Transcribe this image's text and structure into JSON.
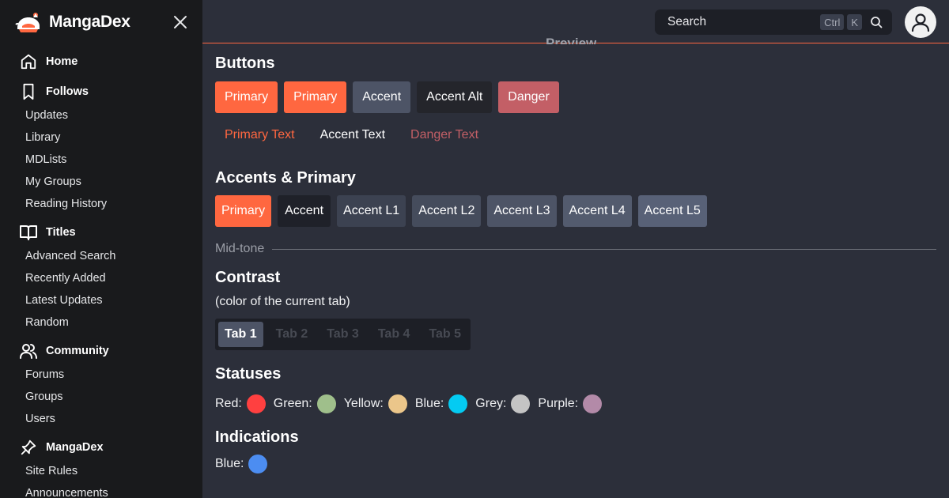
{
  "sidebar": {
    "brand": "MangaDex",
    "sections": [
      {
        "label": "Home",
        "icon": "home-icon",
        "items": []
      },
      {
        "label": "Follows",
        "icon": "bookmark-icon",
        "items": [
          "Updates",
          "Library",
          "MDLists",
          "My Groups",
          "Reading History"
        ]
      },
      {
        "label": "Titles",
        "icon": "book-open-icon",
        "items": [
          "Advanced Search",
          "Recently Added",
          "Latest Updates",
          "Random"
        ]
      },
      {
        "label": "Community",
        "icon": "users-icon",
        "items": [
          "Forums",
          "Groups",
          "Users"
        ]
      },
      {
        "label": "MangaDex",
        "icon": "pin-icon",
        "items": [
          "Site Rules",
          "Announcements"
        ]
      }
    ]
  },
  "header": {
    "search_label": "Search",
    "kbd_ctrl": "Ctrl",
    "kbd_k": "K",
    "preview_title": "Preview",
    "accent_color": "#ff6740"
  },
  "buttons": {
    "title": "Buttons",
    "items": [
      {
        "label": "Primary",
        "color": "#ff6740"
      },
      {
        "label": "Primary",
        "color": "#ff6740"
      },
      {
        "label": "Accent",
        "color": "#4d5466"
      },
      {
        "label": "Accent Alt",
        "color": "#24252b"
      },
      {
        "label": "Danger",
        "color": "#c35f66"
      }
    ],
    "text_items": [
      {
        "label": "Primary Text",
        "color": "#ff6740"
      },
      {
        "label": "Accent Text",
        "color": "#ffffff"
      },
      {
        "label": "Danger Text",
        "color": "#c35f66"
      }
    ]
  },
  "accents": {
    "title": "Accents & Primary",
    "items": [
      {
        "label": "Primary",
        "color": "#ff6740"
      },
      {
        "label": "Accent",
        "color": "#1f2129"
      },
      {
        "label": "Accent L1",
        "color": "#3c4251"
      },
      {
        "label": "Accent L2",
        "color": "#454c5c"
      },
      {
        "label": "Accent L3",
        "color": "#4d5466"
      },
      {
        "label": "Accent L4",
        "color": "#535b6e"
      },
      {
        "label": "Accent L5",
        "color": "#586177"
      }
    ],
    "divider_label": "Mid-tone"
  },
  "contrast": {
    "title": "Contrast",
    "note": "(color of the current tab)",
    "tabs": [
      "Tab 1",
      "Tab 2",
      "Tab 3",
      "Tab 4",
      "Tab 5"
    ],
    "active_index": 0
  },
  "statuses": {
    "title": "Statuses",
    "items": [
      {
        "label": "Red:",
        "color": "#ff4040"
      },
      {
        "label": "Green:",
        "color": "#9fbf8b"
      },
      {
        "label": "Yellow:",
        "color": "#ebc68a"
      },
      {
        "label": "Blue:",
        "color": "#04cbf2"
      },
      {
        "label": "Grey:",
        "color": "#c4c4c4"
      },
      {
        "label": "Purple:",
        "color": "#b38aa8"
      }
    ]
  },
  "indications": {
    "title": "Indications",
    "items": [
      {
        "label": "Blue:",
        "color": "#4c8df1"
      }
    ]
  }
}
